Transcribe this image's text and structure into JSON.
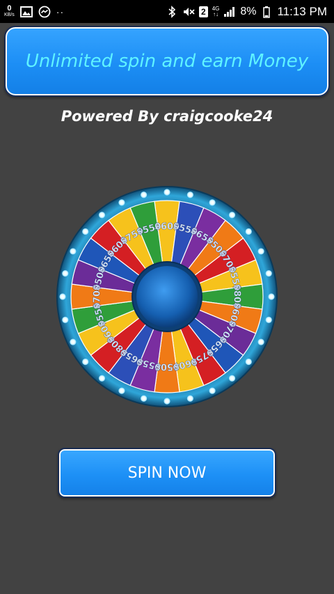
{
  "status_bar": {
    "net_speed_value": "0",
    "net_speed_unit": "KB/s",
    "dots": "··",
    "sim_number": "2",
    "network_type_top": "4G",
    "network_type_bottom": "↑↓",
    "battery_percent": "8%",
    "time": "11:13 PM"
  },
  "banner": {
    "title": "Unlimited spin and earn Money"
  },
  "powered_by": "Powered By craigcooke24",
  "wheel": {
    "segments": [
      {
        "value": "600",
        "color": "#f6c21c"
      },
      {
        "value": "550",
        "color": "#2c4fb8"
      },
      {
        "value": "650",
        "color": "#7a2ea0"
      },
      {
        "value": "500",
        "color": "#f07a16"
      },
      {
        "value": "700",
        "color": "#d41f23"
      },
      {
        "value": "550",
        "color": "#f6c21c"
      },
      {
        "value": "800",
        "color": "#2f9e3a"
      },
      {
        "value": "600",
        "color": "#f07a16"
      },
      {
        "value": "700",
        "color": "#6b2c98"
      },
      {
        "value": "650",
        "color": "#1f56b8"
      },
      {
        "value": "750",
        "color": "#d41f23"
      },
      {
        "value": "600",
        "color": "#f6c21c"
      },
      {
        "value": "500",
        "color": "#f07a16"
      },
      {
        "value": "550",
        "color": "#7a2ea0"
      },
      {
        "value": "650",
        "color": "#2c4fb8"
      },
      {
        "value": "800",
        "color": "#d41f23"
      },
      {
        "value": "600",
        "color": "#f6c21c"
      },
      {
        "value": "550",
        "color": "#2f9e3a"
      },
      {
        "value": "700",
        "color": "#f07a16"
      },
      {
        "value": "500",
        "color": "#6b2c98"
      },
      {
        "value": "650",
        "color": "#1f56b8"
      },
      {
        "value": "600",
        "color": "#d41f23"
      },
      {
        "value": "750",
        "color": "#f6c21c"
      },
      {
        "value": "550",
        "color": "#2f9e3a"
      }
    ],
    "rim_color": "#1f7fb4",
    "hub_color": "#1a6fc0"
  },
  "spin_button": {
    "label": "SPIN NOW"
  }
}
